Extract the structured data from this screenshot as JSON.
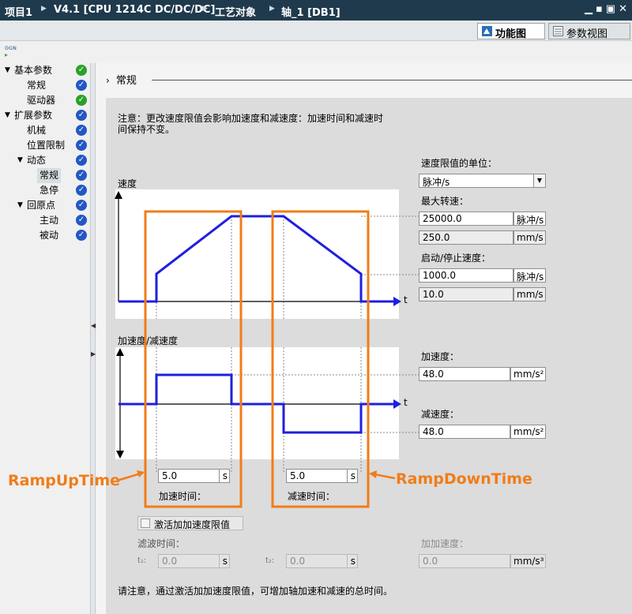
{
  "titlebar": {
    "project": "项目1",
    "device": "V4.1 [CPU 1214C DC/DC/DC]",
    "objects": "工艺对象",
    "axis": "轴_1 [DB1]",
    "controls": [
      "▁",
      "▪",
      "▣",
      "✕"
    ]
  },
  "view_tabs": {
    "function_view": "功能图",
    "param_view": "参数视图"
  },
  "toolbar_icon_text": "ᴏɢɴ",
  "nav": [
    {
      "label": "基本参数",
      "status": "green",
      "expanded": true
    },
    {
      "label": "常规",
      "status": "blue"
    },
    {
      "label": "驱动器",
      "status": "green"
    },
    {
      "label": "扩展参数",
      "status": "blue",
      "expanded": true
    },
    {
      "label": "机械",
      "status": "blue"
    },
    {
      "label": "位置限制",
      "status": "blue"
    },
    {
      "label": "动态",
      "status": "blue",
      "expanded": true
    },
    {
      "label": "常规",
      "status": "blue",
      "selected": true
    },
    {
      "label": "急停",
      "status": "blue"
    },
    {
      "label": "回原点",
      "status": "blue",
      "expanded": true
    },
    {
      "label": "主动",
      "status": "blue"
    },
    {
      "label": "被动",
      "status": "blue"
    }
  ],
  "section": {
    "title": "常规",
    "chevron": "›"
  },
  "note": {
    "line1": "注意：更改速度限值会影响加速度和减速度：加速时间和减速时",
    "line2": "间保持不变。"
  },
  "speed_chart": {
    "title": "速度",
    "axis_t": "t"
  },
  "accel_chart": {
    "title": "加速度/减速度",
    "axis_t": "t"
  },
  "speed_unit": {
    "label": "速度限值的单位：",
    "value": "脉冲/s"
  },
  "max_speed": {
    "label": "最大转速：",
    "value": "25000.0",
    "unit": "脉冲/s",
    "value2": "250.0",
    "unit2": "mm/s"
  },
  "start_stop_speed": {
    "label": "启动/停止速度：",
    "value": "1000.0",
    "unit": "脉冲/s",
    "value2": "10.0",
    "unit2": "mm/s"
  },
  "acceleration": {
    "label": "加速度：",
    "value": "48.0",
    "unit": "mm/s²"
  },
  "deceleration": {
    "label": "减速度：",
    "value": "48.0",
    "unit": "mm/s²"
  },
  "ramp_up": {
    "value": "5.0",
    "unit": "s",
    "label": "加速时间：",
    "annotation": "RampUpTime"
  },
  "ramp_down": {
    "value": "5.0",
    "unit": "s",
    "label": "减速时间：",
    "annotation": "RampDownTime"
  },
  "jerk": {
    "checkbox_label": "激活加加速度限值",
    "filter_time_label": "滤波时间：",
    "t1_label": "t₁:",
    "t1_value": "0.0",
    "t1_unit": "s",
    "t2_label": "t₂:",
    "t2_value": "0.0",
    "t2_unit": "s",
    "jerk_label": "加加速度：",
    "jerk_value": "0.0",
    "jerk_unit": "mm/s³"
  },
  "footer_note": "请注意，通过激活加加速度限值，可增加轴加速和减速的总时间。",
  "colors": {
    "titlebar": "#1f3a4d",
    "curve": "#1f1fe0",
    "annotation": "#f07d19",
    "status_green": "#2aa02a",
    "status_blue": "#2457c5"
  }
}
